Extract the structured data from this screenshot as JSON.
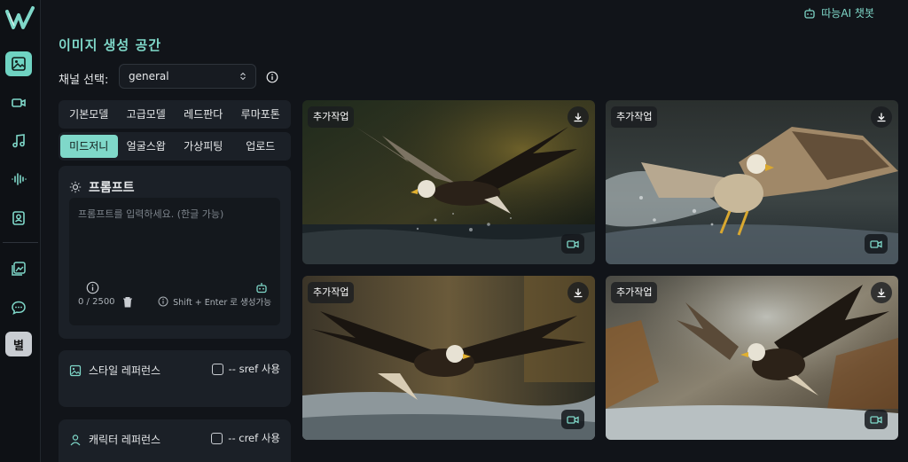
{
  "app": {
    "top_link": "따능AI 챗봇",
    "page_title": "이미지 생성 공간"
  },
  "sidebar": {
    "items": [
      {
        "icon": "image-icon",
        "active": true
      },
      {
        "icon": "video-icon"
      },
      {
        "icon": "music-icon"
      },
      {
        "icon": "audio-wave-icon"
      },
      {
        "icon": "portrait-icon"
      },
      {
        "icon": "gallery-icon"
      },
      {
        "icon": "chat-icon"
      },
      {
        "icon": "star-icon",
        "label": "별"
      }
    ]
  },
  "channel": {
    "label": "채널 선택:",
    "value": "general"
  },
  "tabs_row1": [
    "기본모델",
    "고급모델",
    "레드판다",
    "루마포톤"
  ],
  "tabs_row2": [
    "미드저니",
    "얼굴스왑",
    "가상피팅",
    "업로드"
  ],
  "prompt": {
    "title": "프롬프트",
    "placeholder": "프롬프트를 입력하세요. (한글 가능)",
    "count": "0 / 2500",
    "hint": "Shift + Enter 로 생성가능"
  },
  "style_ref": {
    "title": "스타일 레퍼런스",
    "check_label": "-- sref 사용"
  },
  "char_ref": {
    "title": "캐릭터 레퍼런스",
    "check_label": "-- cref 사용"
  },
  "images": [
    {
      "badge": "추가작업"
    },
    {
      "badge": "추가작업"
    },
    {
      "badge": "추가작업"
    },
    {
      "badge": "추가작업"
    }
  ],
  "colors": {
    "accent": "#7fd8c9",
    "background": "#111419",
    "panel": "#1b2027"
  }
}
